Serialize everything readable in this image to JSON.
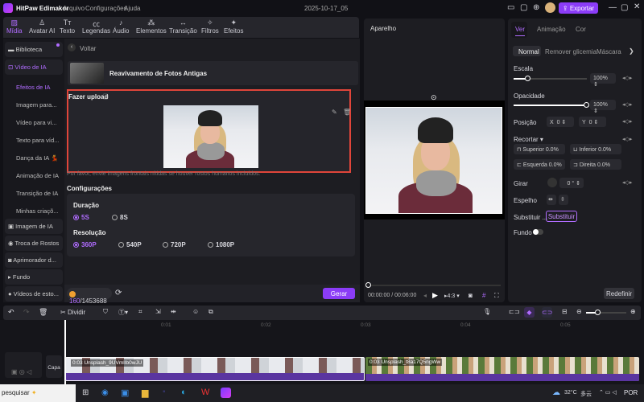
{
  "app": {
    "title": "HitPaw Edimakor",
    "menu": [
      "Arquivo",
      "Configurações",
      "Ajuda"
    ],
    "project_name": "2025-10-17_05",
    "export_label": "Exportar",
    "accent": "#8b3cf7"
  },
  "toolbar_tabs": [
    {
      "label": "Mídia",
      "icon": "media-icon",
      "active": true
    },
    {
      "label": "Avatar AI",
      "icon": "avatar-icon"
    },
    {
      "label": "Texto",
      "icon": "text-icon"
    },
    {
      "label": "Legendas",
      "icon": "captions-icon"
    },
    {
      "label": "Áudio",
      "icon": "audio-icon"
    },
    {
      "label": "Elementos",
      "icon": "elements-icon"
    },
    {
      "label": "Transição",
      "icon": "transition-icon"
    },
    {
      "label": "Filtros",
      "icon": "filters-icon"
    },
    {
      "label": "Efeitos",
      "icon": "effects-icon"
    }
  ],
  "sidebar": {
    "items": [
      {
        "label": "Biblioteca"
      },
      {
        "label": "Vídeo de IA",
        "active": true
      }
    ],
    "sub_items": [
      "Efeitos de IA",
      "Imagem para...",
      "Vídeo para vi...",
      "Texto para víd...",
      "Dança da IA 💃",
      "Animação de IA",
      "Transição de IA",
      "Minhas criaçõ..."
    ],
    "bottom_items": [
      {
        "label": "Imagem de IA"
      },
      {
        "label": "Troca de Rostos"
      },
      {
        "label": "Aprimorador d..."
      },
      {
        "label": "Fundo"
      },
      {
        "label": "Vídeos de esto..."
      }
    ]
  },
  "panel": {
    "back_label": "Voltar",
    "effect_title": "Reavivamento de Fotos Antigas",
    "upload_label": "Fazer upload",
    "hint": "Por favor, envie imagens frontais nítidas se houver rostos humanos incluídos.",
    "settings_title": "Configurações",
    "duration_label": "Duração",
    "duration_options": [
      "5S",
      "8S"
    ],
    "duration_selected": "5S",
    "resolution_label": "Resolução",
    "resolution_options": [
      "360P",
      "540P",
      "720P",
      "1080P"
    ],
    "resolution_selected": "360P",
    "credits_used": "160",
    "credits_total": "/1453688",
    "generate_label": "Gerar"
  },
  "preview": {
    "title": "Aparelho",
    "time_current": "00:00:00",
    "time_total": " / 00:06:00",
    "aspect": "4:3",
    "progress": 0
  },
  "props": {
    "tabs": [
      "Ver",
      "Animação",
      "Cor"
    ],
    "active_tab": "Ver",
    "subtabs": [
      "Normal",
      "Remover glicemia",
      "Máscara"
    ],
    "scale_label": "Escala",
    "scale_value": "100%",
    "scale_level": 0.2,
    "opacity_label": "Opacidade",
    "opacity_value": "100%",
    "opacity_level": 1.0,
    "position_label": "Posição",
    "pos_x_label": "X",
    "pos_x": "0",
    "pos_y_label": "Y",
    "pos_y": "0",
    "crop_label": "Recortar",
    "crop": [
      {
        "label": "Superior",
        "value": "0.0%"
      },
      {
        "label": "Inferior",
        "value": "0.0%"
      },
      {
        "label": "Esquerda",
        "value": "0.0%"
      },
      {
        "label": "Direita",
        "value": "0.0%"
      }
    ],
    "rotate_label": "Girar",
    "rotate_value": "0 °",
    "mirror_label": "Espelho",
    "replace_label": "Substituir ...",
    "replace_button": "Substituir",
    "background_label": "Fundo",
    "reset_label": "Redefinir"
  },
  "timeline": {
    "split_label": "Dividir",
    "ruler": [
      "0:01",
      "0:02",
      "0:03",
      "0:04",
      "0:05"
    ],
    "cover_label": "Capa",
    "clips": [
      {
        "label": "0:03 Unsplash_9UVmlIb0wJU"
      },
      {
        "label": "0:03 Unsplash_t8a17Q5ngWw"
      }
    ],
    "zoom_level": 0.3
  },
  "taskbar": {
    "search_text": "pesquisar",
    "weather": "32°C",
    "weather_desc": "多云",
    "lang": "POR"
  }
}
